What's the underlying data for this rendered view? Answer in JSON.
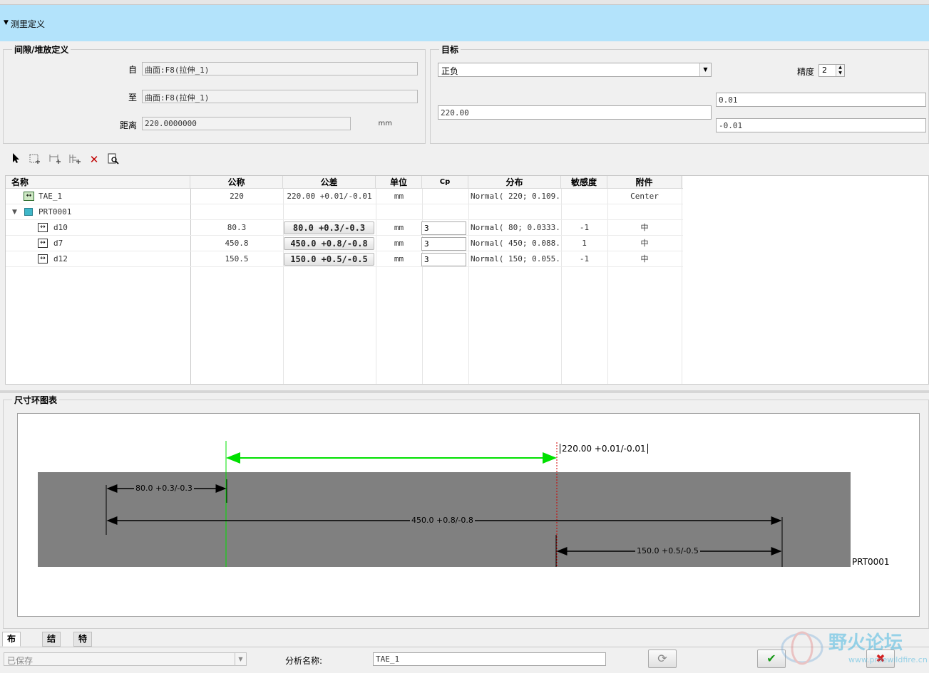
{
  "window": {
    "title": ""
  },
  "section": {
    "label": "测里定义"
  },
  "gap_group": {
    "legend": "间隙/堆放定义",
    "from_label": "自",
    "from_value": "曲面:F8(拉伸_1)",
    "to_label": "至",
    "to_value": "曲面:F8(拉伸_1)",
    "distance_label": "距离",
    "distance_value": "220.0000000",
    "distance_unit": "mm"
  },
  "target_group": {
    "legend": "目标",
    "mode_value": "正负",
    "precision_label": "精度",
    "precision_value": "2",
    "nominal_value": "220.00",
    "upper_value": "0.01",
    "lower_value": "-0.01"
  },
  "table": {
    "columns": [
      "名称",
      "公称",
      "公差",
      "单位",
      "Cp",
      "分布",
      "敏感度",
      "附件"
    ],
    "rows": [
      {
        "name": "TAE_1",
        "nominal": "220",
        "tolerance": "220.00 +0.01/-0.01",
        "unit": "mm",
        "cp": "",
        "distribution": "Normal( 220; 0.109...",
        "sensitivity": "",
        "attachment": "Center",
        "kind": "tae"
      },
      {
        "name": "PRT0001",
        "nominal": "",
        "tolerance": "",
        "unit": "",
        "cp": "",
        "distribution": "",
        "sensitivity": "",
        "attachment": "",
        "kind": "part"
      },
      {
        "name": "d10",
        "nominal": "80.3",
        "tolerance": "80.0 +0.3/-0.3",
        "unit": "mm",
        "cp": "3",
        "distribution": "Normal( 80; 0.0333...",
        "sensitivity": "-1",
        "attachment": "中",
        "kind": "dim"
      },
      {
        "name": "d7",
        "nominal": "450.8",
        "tolerance": "450.0 +0.8/-0.8",
        "unit": "mm",
        "cp": "3",
        "distribution": "Normal( 450; 0.088...",
        "sensitivity": "1",
        "attachment": "中",
        "kind": "dim"
      },
      {
        "name": "d12",
        "nominal": "150.5",
        "tolerance": "150.0 +0.5/-0.5",
        "unit": "mm",
        "cp": "3",
        "distribution": "Normal( 150; 0.055...",
        "sensitivity": "-1",
        "attachment": "中",
        "kind": "dim"
      }
    ]
  },
  "diagram": {
    "legend": "尺寸环图表",
    "target_label": "220.00 +0.01/-0.01",
    "dim1_label": "80.0 +0.3/-0.3",
    "dim2_label": "450.0 +0.8/-0.8",
    "dim3_label": "150.0 +0.5/-0.5",
    "part_label": "PRT0001"
  },
  "tabs": [
    "布线图",
    "结果",
    "特征"
  ],
  "bottom": {
    "status_value": "已保存",
    "analysis_name_label": "分析名称:",
    "analysis_name_value": "TAE_1"
  },
  "watermark": {
    "text": "野火论坛",
    "url": "www.proewildfire.cn"
  },
  "colors": {
    "header_bg": "#b3e3fb",
    "target_green": "#00e000",
    "part_gray": "#808080",
    "ok_green": "#1a9a1a",
    "cancel_red": "#d42020"
  },
  "icons": [
    "select-arrow-icon",
    "add-surface-icon",
    "add-dim-icon",
    "add-chain-icon",
    "delete-icon",
    "preview-icon",
    "refresh-icon",
    "ok-check-icon",
    "cancel-x-icon"
  ]
}
